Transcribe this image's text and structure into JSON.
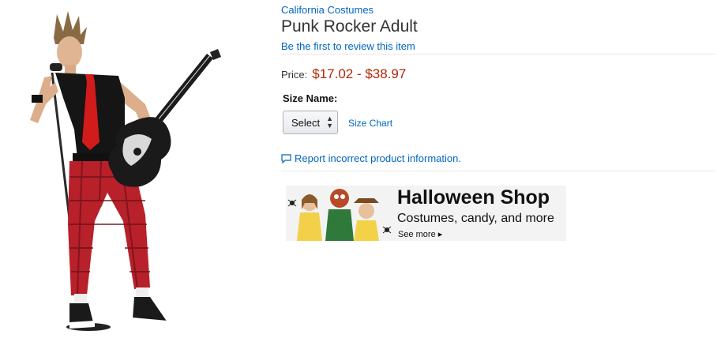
{
  "product": {
    "brand": "California Costumes",
    "title": "Punk Rocker Adult",
    "review_link": "Be the first to review this item",
    "price_label": "Price:",
    "price_value": "$17.02 - $38.97",
    "size_label": "Size Name:",
    "size_select_value": "Select",
    "size_chart_link": "Size Chart",
    "report_link": "Report incorrect product information."
  },
  "banner": {
    "title": "Halloween Shop",
    "subtitle": "Costumes, candy, and more",
    "see_more": "See more ▸"
  },
  "colors": {
    "link": "#0066c0",
    "price": "#b12704",
    "divider": "#e7e7e7"
  },
  "icons": {
    "select_arrows": "up-down-arrows-icon",
    "report": "comment-icon"
  }
}
